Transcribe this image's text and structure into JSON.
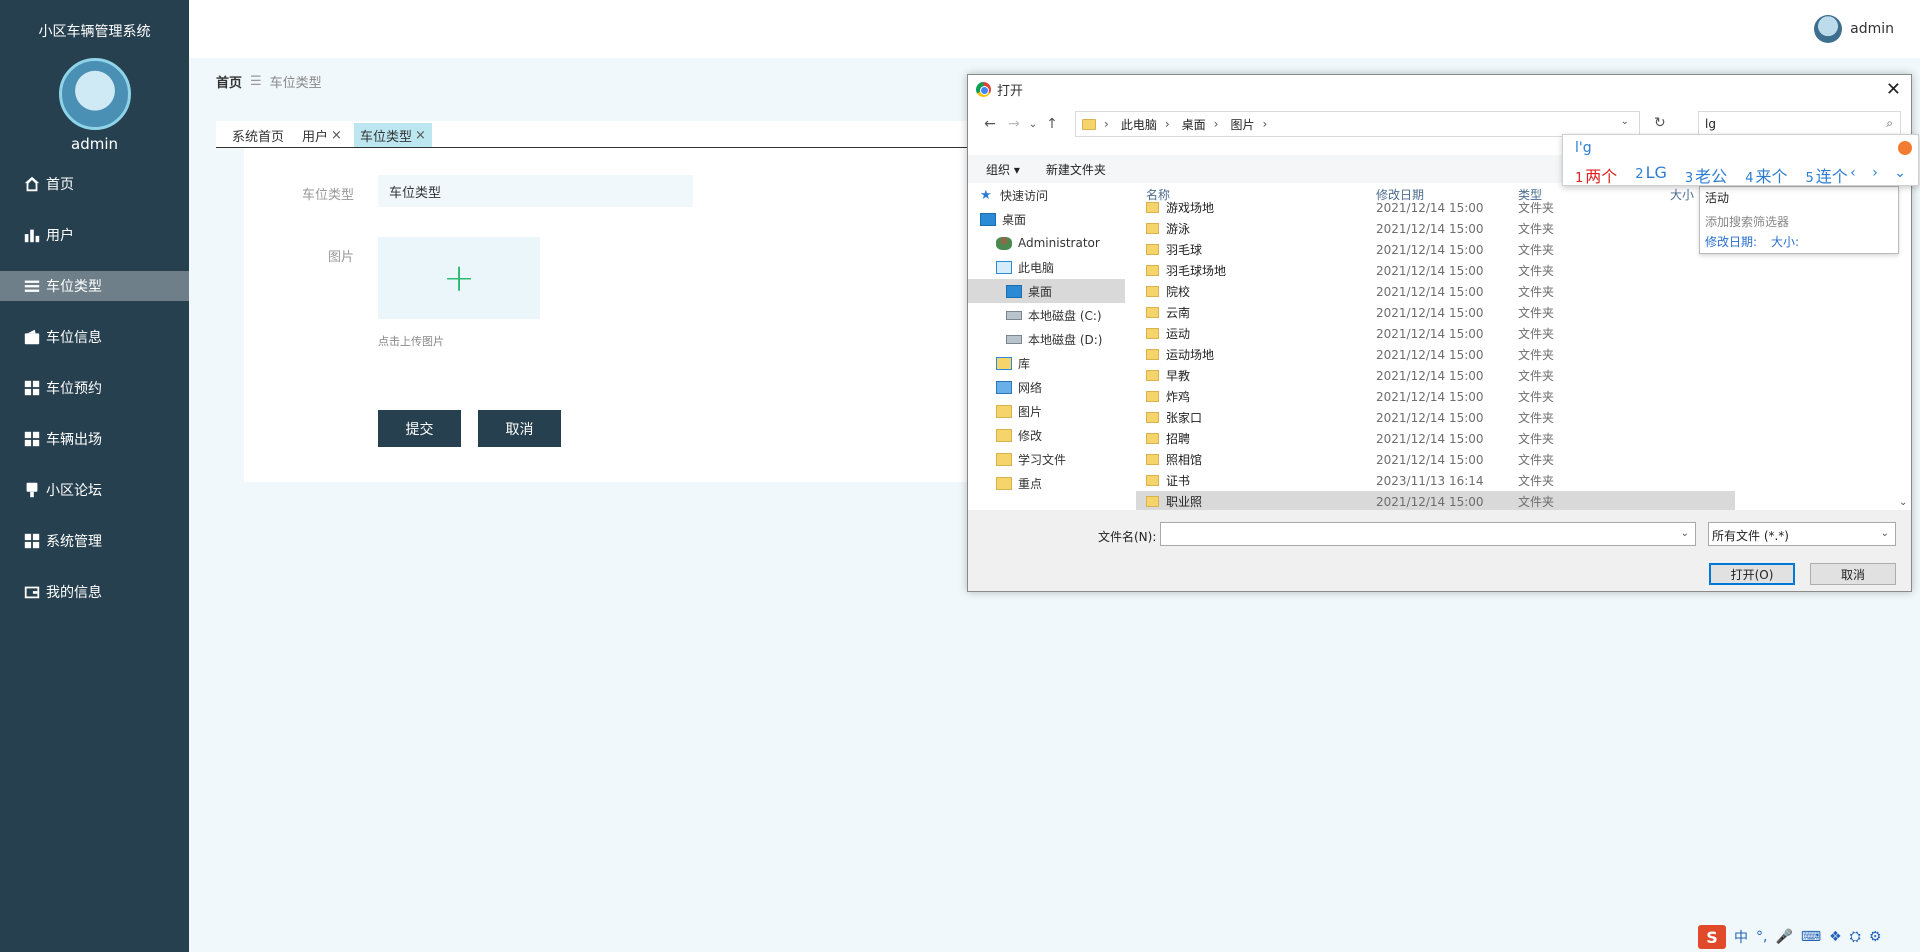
{
  "app": {
    "title": "小区车辆管理系统",
    "username": "admin"
  },
  "sidebar": {
    "items": [
      {
        "label": "首页",
        "icon": "home-icon"
      },
      {
        "label": "用户",
        "icon": "bar-chart-icon"
      },
      {
        "label": "车位类型",
        "icon": "list-icon",
        "active": true
      },
      {
        "label": "车位信息",
        "icon": "wallet-icon"
      },
      {
        "label": "车位预约",
        "icon": "grid-icon"
      },
      {
        "label": "车辆出场",
        "icon": "grid-icon"
      },
      {
        "label": "小区论坛",
        "icon": "stamp-icon"
      },
      {
        "label": "系统管理",
        "icon": "grid-icon"
      },
      {
        "label": "我的信息",
        "icon": "card-icon"
      }
    ]
  },
  "header": {
    "user": "admin"
  },
  "breadcrumb": {
    "home": "首页",
    "sep": "☰",
    "current": "车位类型"
  },
  "tabs": [
    {
      "label": "系统首页",
      "closable": false
    },
    {
      "label": "用户",
      "closable": true
    },
    {
      "label": "车位类型",
      "closable": true,
      "active": true
    }
  ],
  "form": {
    "type_label": "车位类型",
    "type_value": "车位类型",
    "image_label": "图片",
    "upload_tip": "点击上传图片",
    "submit": "提交",
    "cancel": "取消"
  },
  "dialog": {
    "title": "打开",
    "path": [
      "此电脑",
      "桌面",
      "图片"
    ],
    "search_text": "lg",
    "organize": "组织 ▾",
    "new_folder": "新建文件夹",
    "nav": [
      {
        "label": "快速访问",
        "icon": "star"
      },
      {
        "label": "桌面",
        "icon": "desk"
      },
      {
        "label": "Administrator",
        "icon": "person"
      },
      {
        "label": "此电脑",
        "icon": "pc"
      },
      {
        "label": "桌面",
        "icon": "desk",
        "selected": true
      },
      {
        "label": "本地磁盘 (C:)",
        "icon": "disk"
      },
      {
        "label": "本地磁盘 (D:)",
        "icon": "disk"
      },
      {
        "label": "库",
        "icon": "lib"
      },
      {
        "label": "网络",
        "icon": "net"
      },
      {
        "label": "图片",
        "icon": "fold"
      },
      {
        "label": "修改",
        "icon": "fold"
      },
      {
        "label": "学习文件",
        "icon": "fold"
      },
      {
        "label": "重点",
        "icon": "fold"
      }
    ],
    "columns": {
      "name": "名称",
      "date": "修改日期",
      "type": "类型",
      "size": "大小"
    },
    "files": [
      {
        "name": "游戏场地",
        "date": "2021/12/14 15:00",
        "type": "文件夹"
      },
      {
        "name": "游泳",
        "date": "2021/12/14 15:00",
        "type": "文件夹"
      },
      {
        "name": "羽毛球",
        "date": "2021/12/14 15:00",
        "type": "文件夹"
      },
      {
        "name": "羽毛球场地",
        "date": "2021/12/14 15:00",
        "type": "文件夹"
      },
      {
        "name": "院校",
        "date": "2021/12/14 15:00",
        "type": "文件夹"
      },
      {
        "name": "云南",
        "date": "2021/12/14 15:00",
        "type": "文件夹"
      },
      {
        "name": "运动",
        "date": "2021/12/14 15:00",
        "type": "文件夹"
      },
      {
        "name": "运动场地",
        "date": "2021/12/14 15:00",
        "type": "文件夹"
      },
      {
        "name": "早教",
        "date": "2021/12/14 15:00",
        "type": "文件夹"
      },
      {
        "name": "炸鸡",
        "date": "2021/12/14 15:00",
        "type": "文件夹"
      },
      {
        "name": "张家口",
        "date": "2021/12/14 15:00",
        "type": "文件夹"
      },
      {
        "name": "招聘",
        "date": "2021/12/14 15:00",
        "type": "文件夹"
      },
      {
        "name": "照相馆",
        "date": "2021/12/14 15:00",
        "type": "文件夹"
      },
      {
        "name": "证书",
        "date": "2023/11/13 16:14",
        "type": "文件夹"
      },
      {
        "name": "职业照",
        "date": "2021/12/14 15:00",
        "type": "文件夹",
        "selected": true
      }
    ],
    "filename_label": "文件名(N):",
    "filename_value": "",
    "filetype": "所有文件 (*.*)",
    "open": "打开(O)",
    "cancel": "取消"
  },
  "ime": {
    "composition": "l'g",
    "candidates": [
      {
        "n": "1",
        "text": "两个"
      },
      {
        "n": "2",
        "text": "LG"
      },
      {
        "n": "3",
        "text": "老公"
      },
      {
        "n": "4",
        "text": "来个"
      },
      {
        "n": "5",
        "text": "连个"
      }
    ],
    "arrows": "‹ › ⌄"
  },
  "suggestions": {
    "item": "活动",
    "add_filter": "添加搜索筛选器",
    "modified": "修改日期:",
    "size": "大小:"
  },
  "tray": {
    "logo": "S",
    "lang": "中",
    "punct": "°,",
    "icons": [
      "mic-icon",
      "keyboard-icon",
      "skin-icon",
      "game-icon",
      "settings-icon"
    ]
  }
}
